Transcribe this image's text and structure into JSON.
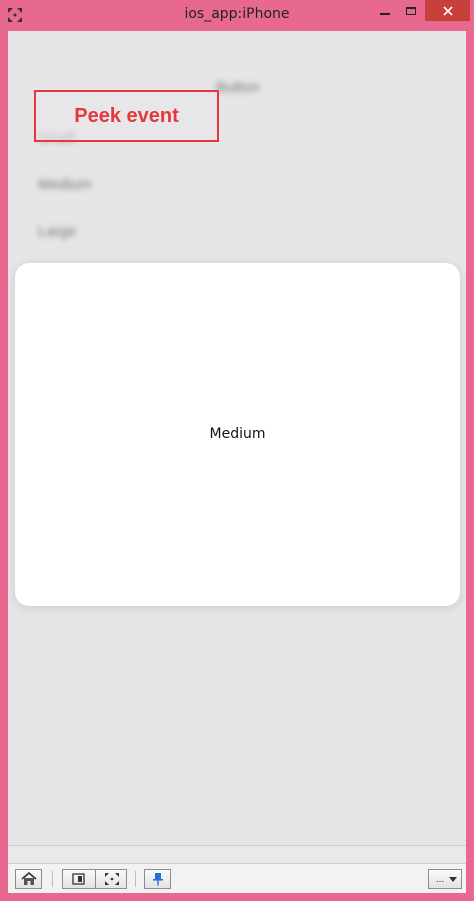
{
  "window": {
    "title": "ios_app:iPhone",
    "controls": [
      "minimize-icon",
      "maximize-icon",
      "close-icon"
    ]
  },
  "background_list": {
    "items": [
      "Button",
      "Small",
      "Medium",
      "Large"
    ]
  },
  "annotation": {
    "label": "Peek event",
    "color": "#e4393c"
  },
  "peek_card": {
    "text": "Medium"
  },
  "toolbar": {
    "buttons": [
      "home-icon",
      "rotate-device-icon",
      "fit-screen-icon",
      "pin-icon"
    ],
    "more_label": "..."
  },
  "colors": {
    "frame": "#e8698f",
    "close_button": "#c7413a",
    "device_background": "#e6e6e8",
    "card": "#ffffff"
  }
}
